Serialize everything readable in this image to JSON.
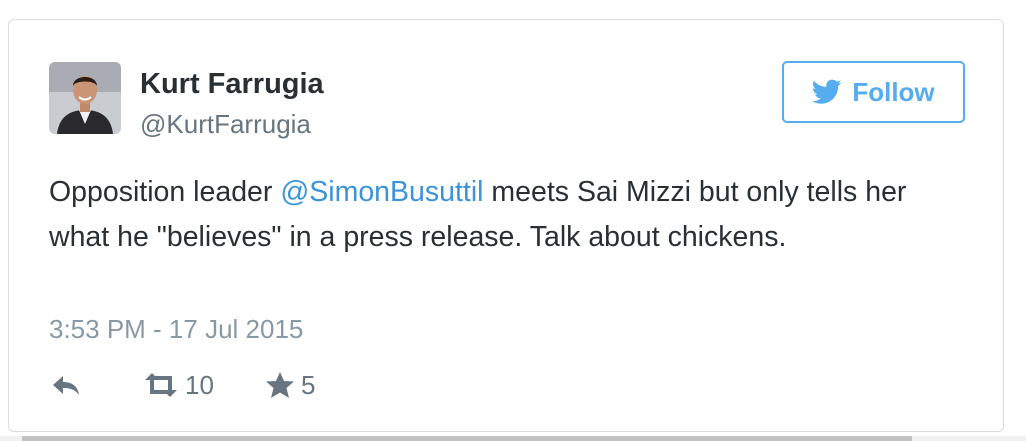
{
  "tweet": {
    "user": {
      "name": "Kurt Farrugia",
      "handle": "@KurtFarrugia"
    },
    "follow_label": "Follow",
    "text": {
      "before_mention": "Opposition leader ",
      "mention": "@SimonBusuttil",
      "after_mention": " meets Sai Mizzi but only tells her what he \"believes\" in a press release. Talk about chickens."
    },
    "timestamp": "3:53 PM - 17 Jul 2015",
    "actions": {
      "reply_icon": "reply-icon",
      "retweet_icon": "retweet-icon",
      "retweet_count": "10",
      "favorite_icon": "star-icon",
      "favorite_count": "5"
    }
  },
  "colors": {
    "accent": "#55acee",
    "mention": "#3b94d9",
    "text": "#292f33",
    "muted": "#8899a6",
    "icon": "#66757f",
    "border": "#d9dde1"
  }
}
